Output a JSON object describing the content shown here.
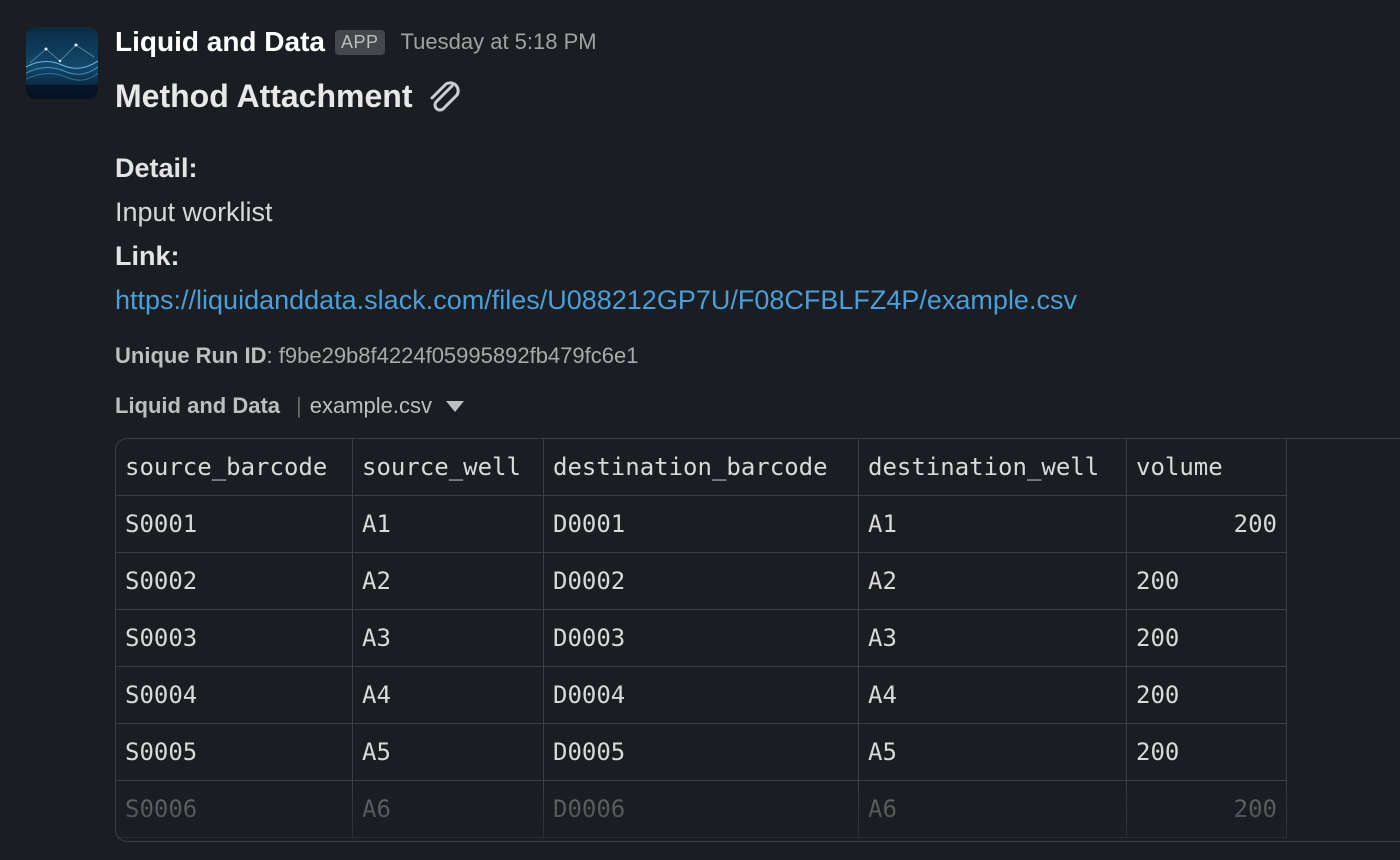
{
  "message": {
    "sender": "Liquid and Data",
    "app_badge": "APP",
    "timestamp": "Tuesday at 5:18 PM",
    "title": "Method Attachment",
    "detail_label": "Detail:",
    "detail_value": "Input worklist",
    "link_label": "Link:",
    "link_url": "https://liquidanddata.slack.com/files/U088212GP7U/F08CFBLFZ4P/example.csv",
    "run_id_label": "Unique Run ID",
    "run_id_value": ": f9be29b8f4224f05995892fb479fc6e1"
  },
  "file": {
    "source": "Liquid and Data",
    "name": "example.csv"
  },
  "table": {
    "headers": [
      "source_barcode",
      "source_well",
      "destination_barcode",
      "destination_well",
      "volume"
    ],
    "rows": [
      [
        "S0001",
        "A1",
        "D0001",
        "A1",
        "200"
      ],
      [
        "S0002",
        "A2",
        "D0002",
        "A2",
        "200"
      ],
      [
        "S0003",
        "A3",
        "D0003",
        "A3",
        "200"
      ],
      [
        "S0004",
        "A4",
        "D0004",
        "A4",
        "200"
      ],
      [
        "S0005",
        "A5",
        "D0005",
        "A5",
        "200"
      ],
      [
        "S0006",
        "A6",
        "D0006",
        "A6",
        "200"
      ]
    ]
  },
  "colors": {
    "background": "#1a1d21",
    "link": "#4a9fd8",
    "border": "#3b3e42"
  },
  "icons": {
    "attachment": "paperclip-icon",
    "file_menu": "caret-down-icon"
  }
}
